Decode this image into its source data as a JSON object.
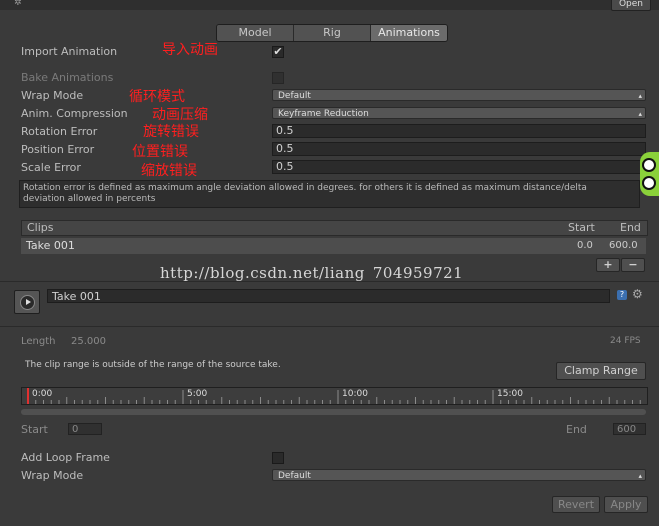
{
  "header": {
    "open_label": "Open"
  },
  "tabs": [
    {
      "label": "Model",
      "active": false
    },
    {
      "label": "Rig",
      "active": false
    },
    {
      "label": "Animations",
      "active": true
    }
  ],
  "settings": {
    "import_animation": {
      "label": "Import Animation",
      "annotation": "导入动画",
      "checked": true
    },
    "bake_animations": {
      "label": "Bake Animations",
      "checked": false
    },
    "wrap_mode": {
      "label": "Wrap Mode",
      "annotation": "循环模式",
      "value": "Default"
    },
    "anim_compression": {
      "label": "Anim. Compression",
      "annotation": "动画压缩",
      "value": "Keyframe Reduction"
    },
    "rotation_error": {
      "label": "Rotation Error",
      "annotation": "旋转错误",
      "value": "0.5"
    },
    "position_error": {
      "label": "Position Error",
      "annotation": "位置错误",
      "value": "0.5"
    },
    "scale_error": {
      "label": "Scale Error",
      "annotation": "缩放错误",
      "value": "0.5"
    }
  },
  "help_text_line1": "Rotation error is defined as maximum angle deviation allowed in degrees. for others it is defined as maximum distance/delta",
  "help_text_line2": "deviation allowed in percents",
  "clips": {
    "headers": {
      "clips": "Clips",
      "start": "Start",
      "end": "End"
    },
    "rows": [
      {
        "name": "Take 001",
        "start": "0.0",
        "end": "600.0"
      }
    ],
    "add_label": "+",
    "remove_label": "−"
  },
  "watermark": "http://blog.csdn.net/liang_704959721",
  "clip_editor": {
    "name": "Take 001",
    "length_label": "Length",
    "length_value": "25.000",
    "fps": "24 FPS",
    "warning": "The clip range is outside of the range of the source take.",
    "clamp_range_label": "Clamp Range",
    "timeline_ticks": [
      "0:00",
      "5:00",
      "10:00",
      "15:00"
    ],
    "start_label": "Start",
    "start_value": "0",
    "end_label": "End",
    "end_value": "600",
    "add_loop_frame_label": "Add Loop Frame",
    "add_loop_frame_checked": false,
    "wrap_mode_label": "Wrap Mode",
    "wrap_mode_value": "Default"
  },
  "footer": {
    "revert_label": "Revert",
    "apply_label": "Apply"
  },
  "colors": {
    "annotation": "#ff1f1f",
    "background": "#3a3a3a",
    "active_tab": "#6b6b6b"
  }
}
